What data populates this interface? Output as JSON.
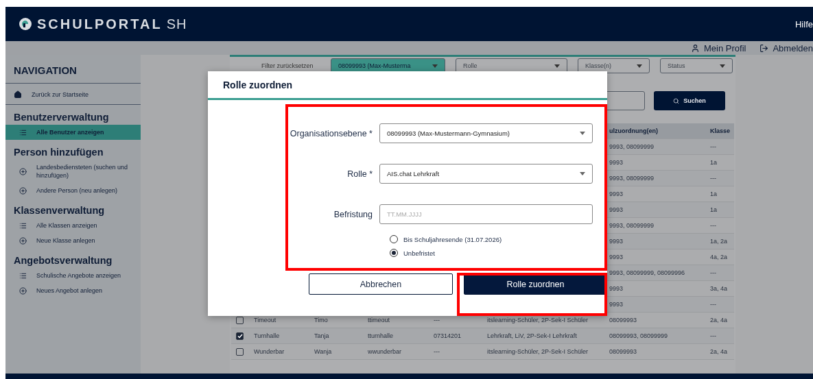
{
  "header": {
    "brand": "SCHULPORTAL",
    "brand_suffix": "SH",
    "help": "Hilfe"
  },
  "user_bar": [
    {
      "kind": "profile",
      "label": "Mein Profil"
    },
    {
      "kind": "logout",
      "label": "Abmelden"
    }
  ],
  "sidebar": {
    "title": "NAVIGATION",
    "home": "Zurück zur Startseite",
    "sections": [
      {
        "title": "Benutzerverwaltung",
        "items": [
          {
            "kind": "list",
            "label": "Alle Benutzer anzeigen",
            "selected": true
          }
        ]
      },
      {
        "title": "Person hinzufügen",
        "items": [
          {
            "kind": "add",
            "label": "Landesbediensteten (suchen und hinzufügen)",
            "selected": false
          },
          {
            "kind": "add",
            "label": "Andere Person (neu anlegen)",
            "selected": false
          }
        ]
      },
      {
        "title": "Klassenverwaltung",
        "items": [
          {
            "kind": "list",
            "label": "Alle Klassen anzeigen",
            "selected": false
          },
          {
            "kind": "add",
            "label": "Neue Klasse anlegen",
            "selected": false
          }
        ]
      },
      {
        "title": "Angebotsverwaltung",
        "items": [
          {
            "kind": "list",
            "label": "Schulische Angebote anzeigen",
            "selected": false
          },
          {
            "kind": "add",
            "label": "Neues Angebot anlegen",
            "selected": false
          }
        ]
      }
    ]
  },
  "filters": {
    "reset": "Filter zurücksetzen",
    "selects": [
      {
        "value": "08099993 (Max-Musterma"
      },
      {
        "placeholder": "Rolle"
      },
      {
        "placeholder": "Klasse(n)"
      },
      {
        "placeholder": "Status"
      }
    ],
    "search_button": "Suchen"
  },
  "table": {
    "columns": [
      "ulzuordnung(en)",
      "Klasse"
    ],
    "rows": [
      {
        "cells": [
          "9993, 08099999",
          "---"
        ]
      },
      {
        "cells": [
          "9993",
          "1a"
        ]
      },
      {
        "cells": [
          "9993, 08099999",
          "---"
        ]
      },
      {
        "cells": [
          "9993",
          "1a"
        ]
      },
      {
        "cells": [
          "9993",
          "1a"
        ]
      },
      {
        "cells": [
          "9993, 08099999",
          "---"
        ]
      },
      {
        "cells": [
          "9993",
          "1a, 2a"
        ]
      },
      {
        "cells": [
          "9993",
          "4a, 2a"
        ]
      },
      {
        "cells": [
          "9993, 08099999, 08099996",
          "---"
        ]
      },
      {
        "cells": [
          "9993",
          "3a, 4a"
        ]
      },
      {
        "cells": [
          "9993",
          "---"
        ]
      },
      {
        "checked": false,
        "cells": [
          "Timeout",
          "Timo",
          "ttimeout",
          "---",
          "itslearning-Schüler, 2P-Sek-I Schüler",
          "08099993",
          "2a, 4a"
        ]
      },
      {
        "checked": true,
        "cells": [
          "Turnhalle",
          "Tanja",
          "tturnhalle",
          "07314201",
          "Lehrkraft, LiV, 2P-Sek-I Lehrkraft",
          "08099993, 08099999",
          "---"
        ]
      },
      {
        "checked": false,
        "cells": [
          "Wunderbar",
          "Wanja",
          "wwunderbar",
          "---",
          "itslearning-Schüler, 2P-Sek-I Schüler",
          "08099993",
          "2a, 4a"
        ]
      }
    ]
  },
  "dialog": {
    "title": "Rolle zuordnen",
    "fields": [
      {
        "kind": "select",
        "label": "Organisationsebene *",
        "value": "08099993 (Max-Mustermann-Gymnasium)"
      },
      {
        "kind": "select",
        "label": "Rolle *",
        "value": "AIS.chat Lehrkraft"
      },
      {
        "kind": "date",
        "label": "Befristung",
        "placeholder": "TT.MM.JJJJ"
      }
    ],
    "options": [
      {
        "label": "Bis Schuljahresende (31.07.2026)",
        "selected": false
      },
      {
        "label": "Unbefristet",
        "selected": true
      }
    ],
    "buttons": [
      {
        "kind": "secondary",
        "label": "Abbrechen"
      },
      {
        "kind": "primary",
        "label": "Rolle zuordnen"
      }
    ]
  }
}
